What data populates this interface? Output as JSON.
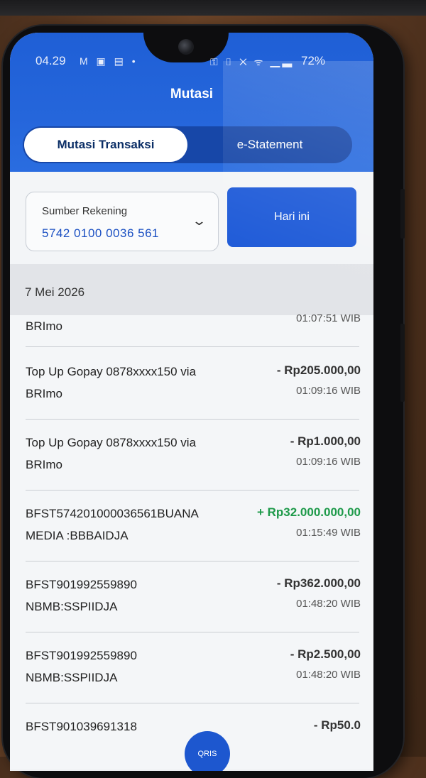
{
  "status_bar": {
    "time": "04.29",
    "left_icons": "M ▣ ▤ •",
    "right_icons": "⚿ ▯ ✕ ᯤ ▁▃",
    "battery": "72%"
  },
  "header": {
    "title": "Mutasi"
  },
  "tabs": [
    {
      "label": "Mutasi Transaksi",
      "active": true
    },
    {
      "label": "e-Statement",
      "active": false
    }
  ],
  "account": {
    "label": "Sumber Rekening",
    "value": "5742 0100 0036 561",
    "chevron": "chevron-down-icon"
  },
  "period_button": {
    "label": "Hari ini"
  },
  "date_header": "7 Mei 2026",
  "transactions": [
    {
      "desc1": "",
      "desc2": "BRImo",
      "amount": "",
      "time": "01:07:51 WIB",
      "type": "debit"
    },
    {
      "desc1": "Top Up Gopay 0878xxxx150 via",
      "desc2": "BRImo",
      "amount": "- Rp205.000,00",
      "time": "01:09:16 WIB",
      "type": "debit"
    },
    {
      "desc1": "Top Up Gopay 0878xxxx150 via",
      "desc2": "BRImo",
      "amount": "- Rp1.000,00",
      "time": "01:09:16 WIB",
      "type": "debit"
    },
    {
      "desc1": "BFST574201000036561BUANA",
      "desc2": "MEDIA :BBBAIDJA",
      "amount": "+ Rp32.000.000,00",
      "time": "01:15:49 WIB",
      "type": "credit"
    },
    {
      "desc1": "BFST901992559890",
      "desc2": "NBMB:SSPIIDJA",
      "amount": "- Rp362.000,00",
      "time": "01:48:20 WIB",
      "type": "debit"
    },
    {
      "desc1": "BFST901992559890",
      "desc2": "NBMB:SSPIIDJA",
      "amount": "- Rp2.500,00",
      "time": "01:48:20 WIB",
      "type": "debit"
    },
    {
      "desc1": "BFST901039691318",
      "desc2": "",
      "amount": "- Rp50.0",
      "time": "",
      "type": "debit"
    }
  ],
  "scan_button": {
    "label": "QRIS"
  },
  "colors": {
    "brand_blue": "#1f5bd8",
    "credit_green": "#1e9a4a"
  }
}
